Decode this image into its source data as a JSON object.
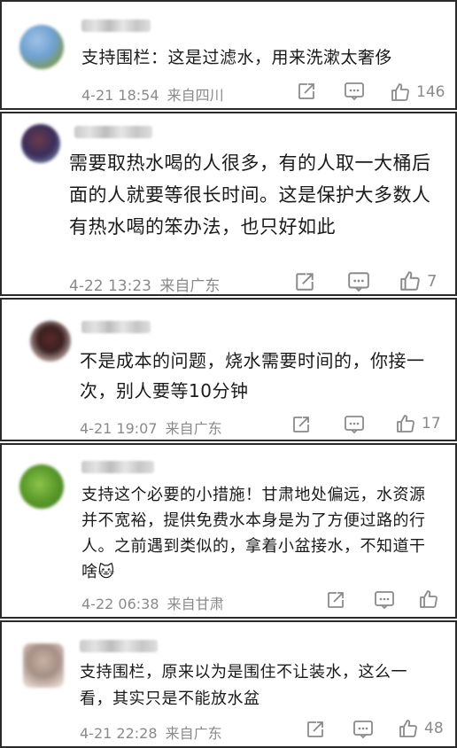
{
  "comments": [
    {
      "text": "支持围栏：这是过滤水，用来洗漱太奢侈",
      "date": "4-21 18:54",
      "location": "来自四川",
      "likes": "146"
    },
    {
      "text": "需要取热水喝的人很多，有的人取一大桶后面的人就要等很长时间。这是保护大多数人有热水喝的笨办法，也只好如此",
      "date": "4-22 13:23",
      "location": "来自广东",
      "likes": "7"
    },
    {
      "text": "不是成本的问题，烧水需要时间的，你接一次，别人要等10分钟",
      "date": "4-21 19:07",
      "location": "来自广东",
      "likes": "17"
    },
    {
      "text": "支持这个必要的小措施！甘肃地处偏远，水资源并不宽裕，提供免费水本身是为了方便过路的行人。之前遇到类似的，拿着小盆接水，不知道干啥🐱",
      "date": "4-22 06:38",
      "location": "来自甘肃",
      "likes": ""
    },
    {
      "text": "支持围栏，原来以为是围住不让装水，这么一看，其实只是不能放水盆",
      "date": "4-21 22:28",
      "location": "来自广东",
      "likes": "48"
    }
  ],
  "icons": {
    "share": "share-icon",
    "comment": "comment-icon",
    "like": "thumbs-up-icon"
  }
}
